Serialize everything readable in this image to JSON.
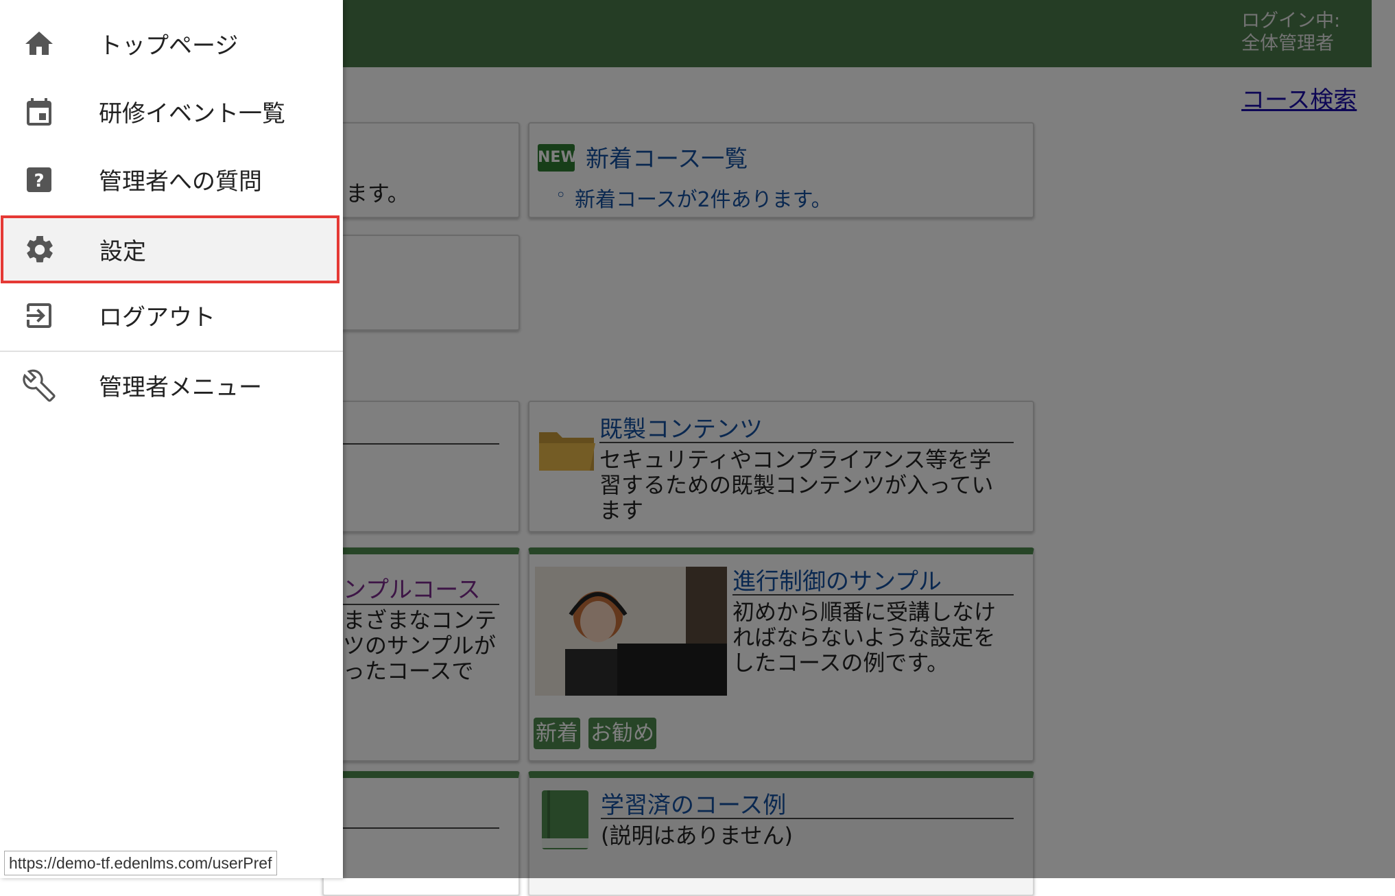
{
  "header": {
    "login_label": "ログイン中:",
    "user_name": "全体管理者"
  },
  "search_link": "コース検索",
  "cards": {
    "partial_top_left_text": "ます。",
    "new_courses": {
      "badge": "NEW",
      "title": "新着コース一覧",
      "bullet": "◦",
      "text": "新着コースが2件あります。"
    },
    "contents": {
      "title": "既製コンテンツ",
      "text": "セキュリティやコンプライアンス等を学習するための既製コンテンツが入っています"
    },
    "sample_course_partial": {
      "title": "ンプルコース",
      "text": "まざまなコンテ\nツのサンプルが\nったコースで"
    },
    "progress_sample": {
      "title": "進行制御のサンプル",
      "text": "初めから順番に受講しなければならないような設定をしたコースの例です。",
      "tags": [
        "新着",
        "お勧め"
      ]
    },
    "completed_example": {
      "title": "学習済のコース例",
      "text": "(説明はありません)"
    }
  },
  "drawer": {
    "items": [
      {
        "label": "トップページ",
        "icon": "home-icon"
      },
      {
        "label": "研修イベント一覧",
        "icon": "calendar-icon"
      },
      {
        "label": "管理者への質問",
        "icon": "help-icon"
      },
      {
        "label": "設定",
        "icon": "gear-icon",
        "selected": true
      },
      {
        "label": "ログアウト",
        "icon": "logout-icon"
      },
      {
        "label": "管理者メニュー",
        "icon": "wrench-icon"
      }
    ]
  },
  "status_bar_url": "https://demo-tf.edenlms.com/userPref",
  "colors": {
    "header_green": "#4a7b4a",
    "link_blue": "#1550a0",
    "highlight_red": "#e53935"
  }
}
